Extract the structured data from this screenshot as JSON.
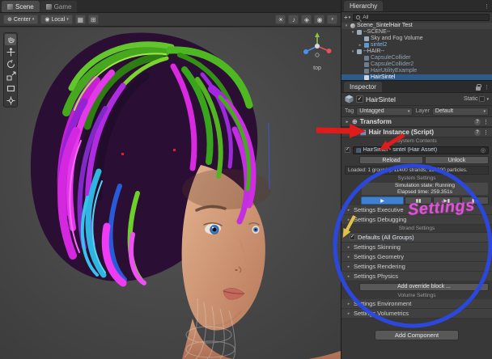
{
  "icons": {
    "caret_open": "▾",
    "caret_closed": "▸",
    "kebab": "⋮",
    "plus": "+",
    "check": "✓",
    "help": "?",
    "picker": "◎",
    "script": "▤",
    "transform": "⊕",
    "grid": "▦",
    "snap": "⊞",
    "sun": "☀",
    "audio": "♪",
    "fx": "◈",
    "camera": "◉"
  },
  "scene": {
    "tabs": [
      {
        "label": "Scene"
      },
      {
        "label": "Game"
      }
    ],
    "toolbar": {
      "pivot_label": "Center",
      "orientation_label": "Local"
    },
    "gizmo": {
      "view_label": "top"
    }
  },
  "hierarchy": {
    "title": "Hierarchy",
    "search_text": "All",
    "items": [
      {
        "label": "Scene_SintelHair Test"
      },
      {
        "label": "--SCENE--"
      },
      {
        "label": "Sky and Fog Volume"
      },
      {
        "label": "sintel2"
      },
      {
        "label": "--HAIR--"
      },
      {
        "label": "CapsuleCollider"
      },
      {
        "label": "CapsuleCollider2"
      },
      {
        "label": "HairUtilityExample"
      },
      {
        "label": "HairSintel"
      }
    ]
  },
  "inspector": {
    "title": "Inspector",
    "header": {
      "name": "HairSintel",
      "static_label": "Static"
    },
    "tag_row": {
      "tag_label": "Tag",
      "tag_value": "Untagged",
      "layer_label": "Layer",
      "layer_value": "Default"
    },
    "transform": {
      "label": "Transform"
    },
    "hair_instance": {
      "label": "Hair Instance (Script)"
    },
    "sections": {
      "system_contents": "System Contents",
      "system_settings": "System Settings",
      "strand_settings": "Strand Settings",
      "volume_settings": "Volume Settings"
    },
    "asset_field": {
      "value": "HairSintel - sintel (Hair Asset)"
    },
    "buttons": {
      "reload": "Reload",
      "unlock": "Unlock",
      "add_override": "Add override block ...",
      "add_component": "Add Component"
    },
    "status": {
      "loaded": "Loaded: 1 group(s), 11400 strands, 136800 particles."
    },
    "simulation": {
      "state": "Simulation state: Running",
      "elapsed": "Elapsed time: 259.351s"
    },
    "playback": {
      "play": "▶",
      "pause": "▮▮",
      "step": "▶▮",
      "rewind": "▮◀"
    },
    "executive_foldouts": [
      {
        "label": "Settings Executive"
      },
      {
        "label": "Settings Debugging"
      }
    ],
    "defaults_field": {
      "label": "Defaults (All Groups)"
    },
    "strand_foldouts": [
      {
        "label": "Settings Skinning"
      },
      {
        "label": "Settings Geometry"
      },
      {
        "label": "Settings Rendering"
      },
      {
        "label": "Settings Physics"
      }
    ],
    "volume_foldouts": [
      {
        "label": "Settings Environment"
      },
      {
        "label": "Settings Volumetrics"
      }
    ]
  },
  "annotations": {
    "settings_label": "Settings",
    "ellipse_color": "#2b49e5",
    "arrow_red": "#e01b1b",
    "arrow_yellow": "#e2c14b"
  }
}
